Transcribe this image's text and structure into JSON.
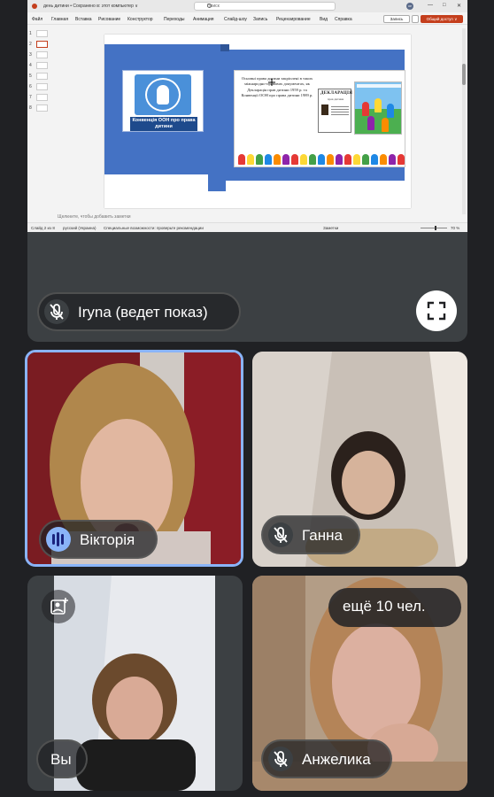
{
  "ppt": {
    "doc_title": "день дитини • Сохранено в: этот компьютер ∨",
    "search_placeholder": "Поиск",
    "avatar_initials": "OP",
    "window_buttons": [
      "—",
      "□",
      "✕"
    ],
    "menu": [
      "Файл",
      "Главная",
      "Вставка",
      "Рисование",
      "Конструктор",
      "Переходы",
      "Анимация",
      "Слайд-шоу",
      "Запись",
      "Рецензирование",
      "Вид",
      "Справка"
    ],
    "record_label": "Запись",
    "share_label": "Общий доступ ∨",
    "slide_numbers": [
      "1",
      "2",
      "3",
      "4",
      "5",
      "6",
      "7",
      "8"
    ],
    "notes_placeholder": "Щелкните, чтобы добавить заметки",
    "status": {
      "slide_info": "Слайд 2 из 8",
      "language": "русский (Украина)",
      "accessibility": "Специальные возможности: проверьте рекомендации",
      "notes": "Заметки",
      "zoom": "70 %"
    },
    "slide": {
      "logo_caption": "Конвенція ООН про права дитини",
      "main_text": "Основні права дитини закріплені в таких міжнародно-правових документах, як Декларація прав дитини 1959 р. та Конвенції ООН про права дитини 1989 р.",
      "book_title": "ДЕКЛАРАЦІЯ",
      "book_subtitle": "прав дитини"
    }
  },
  "presenter": {
    "name": "Iryna (ведет показ)"
  },
  "participants": [
    {
      "name": "Вікторія",
      "speaking": true
    },
    {
      "name": "Ганна",
      "muted": true
    },
    {
      "name": "Вы"
    },
    {
      "name": "Анжелика",
      "muted": true
    }
  ],
  "more_participants": "ещё 10 чел.",
  "colors": {
    "background": "#202124",
    "speaking_border": "#8ab4f8",
    "powerpoint_accent": "#c43e1c",
    "slide_blue": "#4472c4"
  },
  "icons": [
    "mic-off-icon",
    "fullscreen-icon",
    "audio-level-icon",
    "add-photo-icon",
    "search-icon",
    "cursor-icon"
  ]
}
